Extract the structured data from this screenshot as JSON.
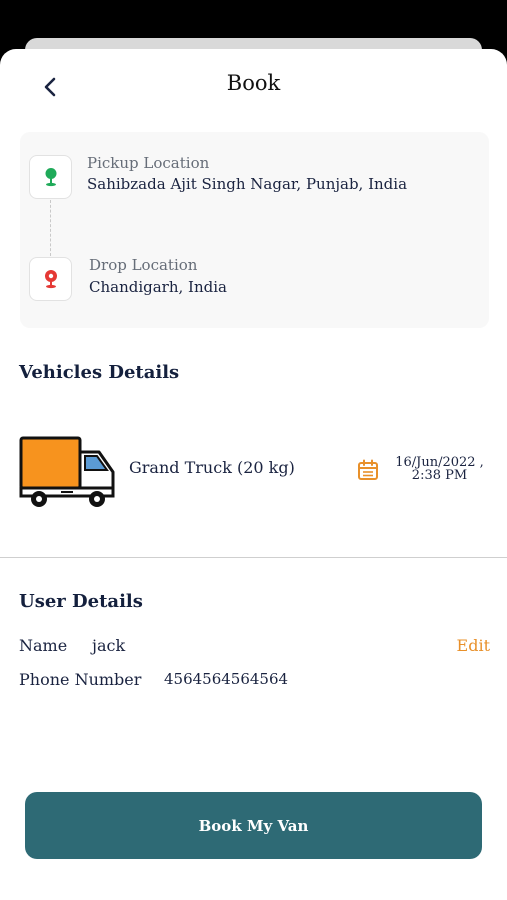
{
  "header": {
    "title": "Book"
  },
  "locations": {
    "pickup": {
      "label": "Pickup Location",
      "value": "Sahibzada Ajit Singh Nagar, Punjab, India"
    },
    "drop": {
      "label": "Drop Location",
      "value": "Chandigarh, India"
    }
  },
  "vehicles": {
    "title": "Vehicles Details",
    "name": "Grand Truck (20 kg)",
    "date_line1": "16/Jun/2022 ,",
    "date_line2": "2:38 PM"
  },
  "user": {
    "title": "User Details",
    "name_label": "Name",
    "name_value": "jack",
    "phone_label": "Phone Number",
    "phone_value": "4564564564564",
    "edit_label": "Edit"
  },
  "actions": {
    "book_label": "Book My Van"
  },
  "colors": {
    "accent_orange": "#e8902a",
    "button_teal": "#2e6a75",
    "pickup_green": "#1faa59",
    "drop_red": "#e53935"
  },
  "icons": {
    "back": "chevron-left-icon",
    "pickup": "location-pin-icon",
    "drop": "location-pin-icon",
    "vehicle": "truck-icon",
    "date": "calendar-icon"
  }
}
